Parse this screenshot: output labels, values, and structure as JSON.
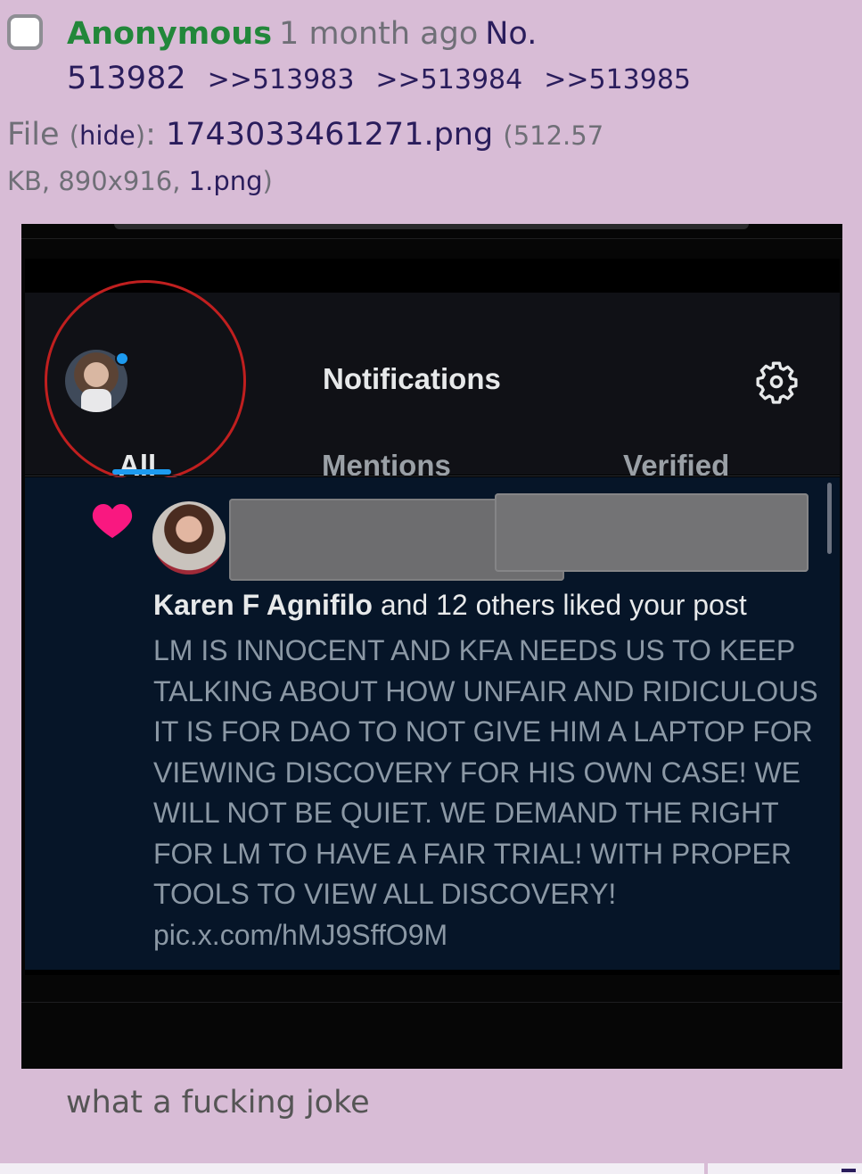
{
  "post": {
    "name": "Anonymous",
    "time": "1 month ago",
    "no_label": "No.",
    "number": "513982",
    "replies": [
      ">>513983",
      ">>513984",
      ">>513985"
    ]
  },
  "file": {
    "label": "File",
    "hide": "hide",
    "filename": "1743033461271.png",
    "size": "512.57",
    "size_unit": "KB",
    "dimensions": "890x916",
    "original_name": "1.png"
  },
  "screenshot": {
    "title": "Notifications",
    "tabs": [
      "All",
      "Mentions",
      "Verified"
    ],
    "liker": "Karen F Agnifilo",
    "liked_text": "and 12 others liked your post",
    "post_text": "LM IS INNOCENT AND KFA NEEDS US TO KEEP TALKING ABOUT HOW UNFAIR AND RIDICULOUS IT IS FOR DAO TO NOT GIVE HIM A LAPTOP FOR VIEWING DISCOVERY FOR HIS OWN CASE! WE WILL NOT BE QUIET. WE DEMAND THE RIGHT FOR LM TO HAVE A FAIR TRIAL! WITH PROPER TOOLS TO VIEW ALL DISCOVERY!",
    "post_link": "pic.x.com/hMJ9SffO9M"
  },
  "comment": "what a fucking joke",
  "colors": {
    "background": "#d8bcd6",
    "name": "#22873a",
    "link": "#2a1d5c",
    "accent_blue": "#1d9bf0",
    "heart": "#f91880",
    "annotation_circle": "#c01f1f"
  }
}
